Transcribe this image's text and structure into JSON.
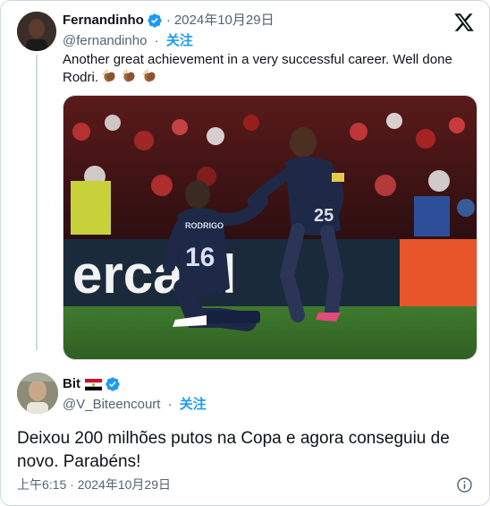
{
  "quoted_tweet": {
    "name": "Fernandinho",
    "date": "2024年10月29日",
    "dot": "·",
    "handle": "@fernandinho",
    "follow_label": "关注",
    "text": "Another great achievement in a very successful career. Well done Rodri.",
    "emojis": [
      "clapping-hands-icon",
      "clapping-hands-icon",
      "clapping-hands-icon"
    ],
    "media": {
      "banner_text": "ercard",
      "player_left_name": "RODRIGO",
      "player_left_number": "16",
      "player_right_number": "25"
    }
  },
  "main_tweet": {
    "name": "Bit",
    "flag": "egypt-flag-icon",
    "handle": "@V_Biteencourt",
    "dot": "·",
    "follow_label": "关注",
    "text": "Deixou 200 milhões putos na Copa e agora conseguiu de novo. Parabéns!",
    "timestamp": "上午6:15 · 2024年10月29日"
  },
  "icons": {
    "verified_color": "#1d9bf0",
    "brand_logo": "x-logo-icon",
    "info": "info-icon"
  }
}
